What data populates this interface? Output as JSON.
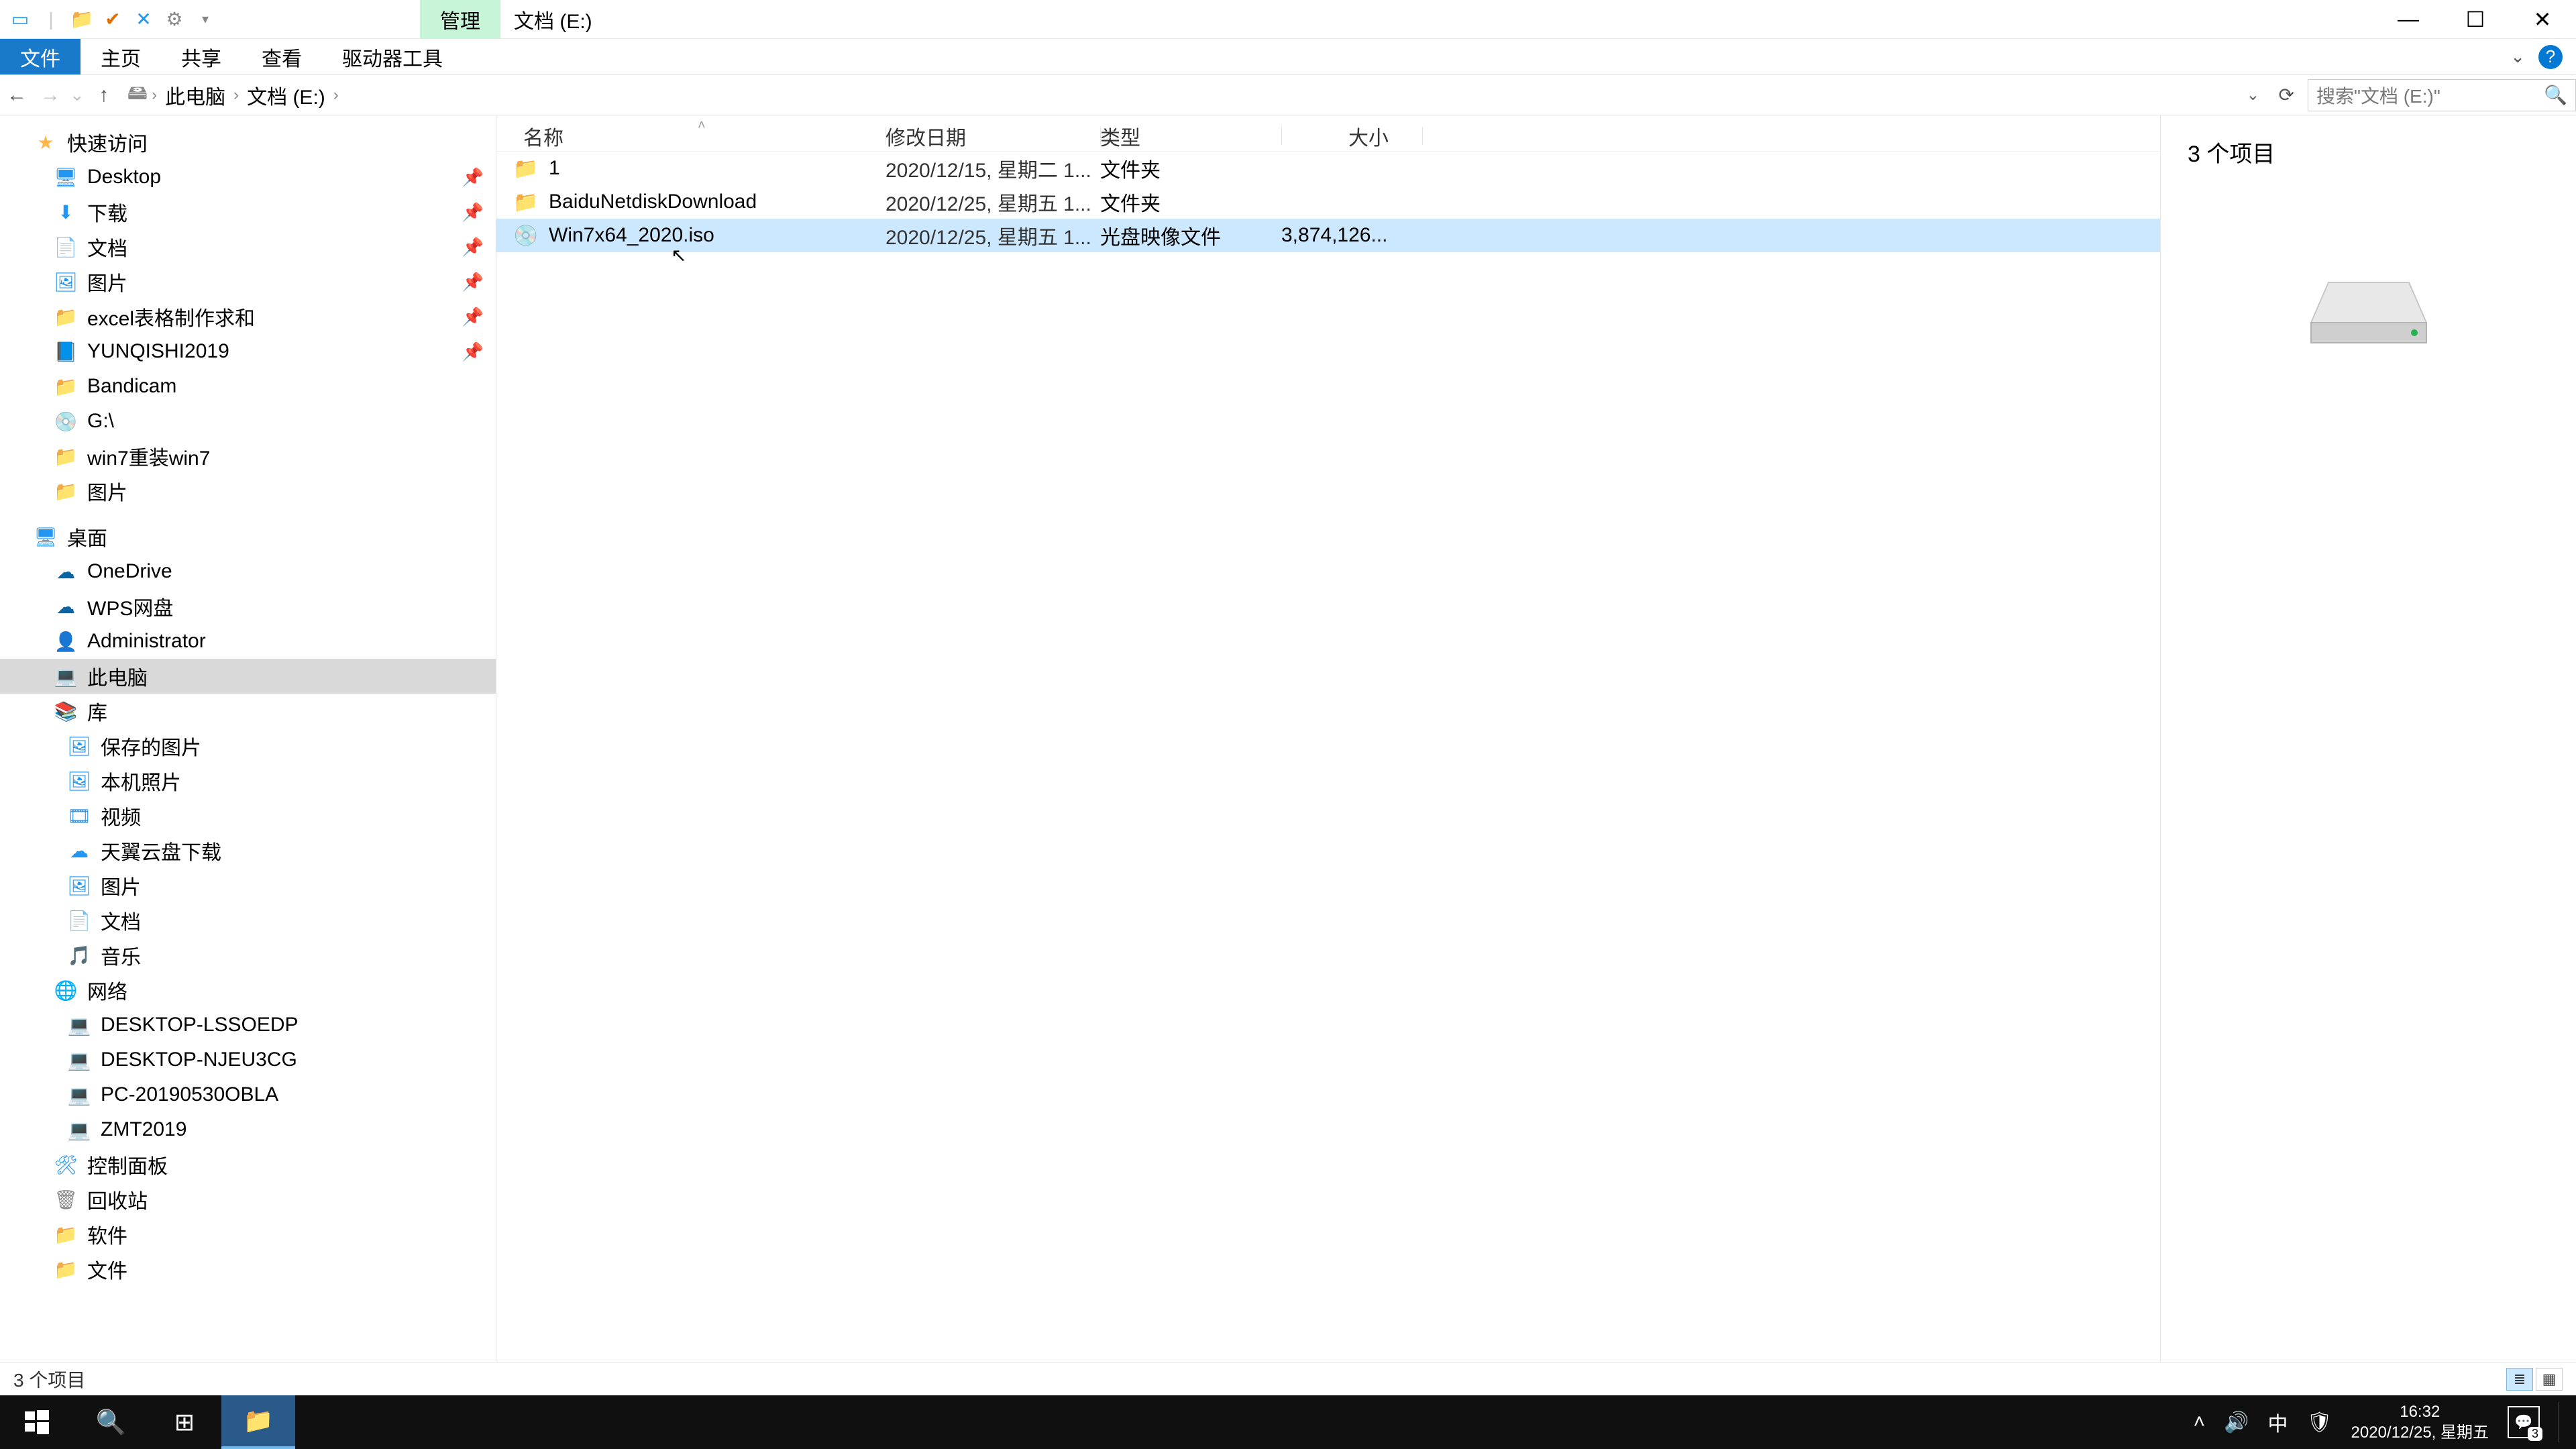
{
  "titlebar": {
    "tool_tab": "管理",
    "location": "文档 (E:)"
  },
  "ribbon": {
    "file": "文件",
    "home": "主页",
    "share": "共享",
    "view": "查看",
    "drive_tools": "驱动器工具"
  },
  "nav": {
    "back_glyph": "←",
    "fwd_glyph": "→",
    "up_glyph": "↑",
    "crumb_pc": "此电脑",
    "crumb_drive": "文档 (E:)",
    "search_placeholder": "搜索\"文档 (E:)\""
  },
  "tree": {
    "quick": "快速访问",
    "desktop": "Desktop",
    "downloads": "下载",
    "documents": "文档",
    "pictures": "图片",
    "excel": "excel表格制作求和",
    "yunqishi": "YUNQISHI2019",
    "bandicam": "Bandicam",
    "g_drive": "G:\\",
    "win7": "win7重装win7",
    "pictures2": "图片",
    "desktop_cn": "桌面",
    "onedrive": "OneDrive",
    "wps": "WPS网盘",
    "admin": "Administrator",
    "this_pc": "此电脑",
    "library": "库",
    "saved_pics": "保存的图片",
    "local_pics": "本机照片",
    "video": "视频",
    "tianyi": "天翼云盘下载",
    "pic_lib": "图片",
    "doc_lib": "文档",
    "music": "音乐",
    "network": "网络",
    "n1": "DESKTOP-LSSOEDP",
    "n2": "DESKTOP-NJEU3CG",
    "n3": "PC-20190530OBLA",
    "n4": "ZMT2019",
    "ctrlpanel": "控制面板",
    "recycle": "回收站",
    "soft": "软件",
    "wenjian": "文件"
  },
  "columns": {
    "name": "名称",
    "date": "修改日期",
    "type": "类型",
    "size": "大小"
  },
  "rows": [
    {
      "icon": "folder",
      "name": "1",
      "date": "2020/12/15, 星期二 1...",
      "type": "文件夹",
      "size": ""
    },
    {
      "icon": "folder",
      "name": "BaiduNetdiskDownload",
      "date": "2020/12/25, 星期五 1...",
      "type": "文件夹",
      "size": ""
    },
    {
      "icon": "iso",
      "name": "Win7x64_2020.iso",
      "date": "2020/12/25, 星期五 1...",
      "type": "光盘映像文件",
      "size": "3,874,126..."
    }
  ],
  "preview_title": "3 个项目",
  "status_text": "3 个项目",
  "taskbar": {
    "time": "16:32",
    "date": "2020/12/25, 星期五",
    "ime": "中",
    "notif_count": "3"
  }
}
